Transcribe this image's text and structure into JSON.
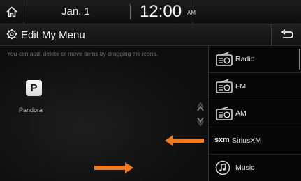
{
  "status": {
    "date": "Jan.  1",
    "time": "12:00",
    "ampm": "AM"
  },
  "header": {
    "title": "Edit My Menu"
  },
  "left": {
    "hint": "You can add, delete or move items by dragging the icons.",
    "tile": {
      "letter": "P",
      "label": "Pandora"
    }
  },
  "menu": {
    "items": [
      {
        "label": "Radio",
        "icon": "radio-icon"
      },
      {
        "label": "FM",
        "icon": "radio-icon"
      },
      {
        "label": "AM",
        "icon": "radio-icon"
      },
      {
        "label": "SiriusXM",
        "logo": "sxm",
        "icon": "sxm-logo"
      },
      {
        "label": "Music",
        "icon": "music-note-icon"
      }
    ]
  },
  "colors": {
    "accent_arrow": "#f07a22"
  }
}
